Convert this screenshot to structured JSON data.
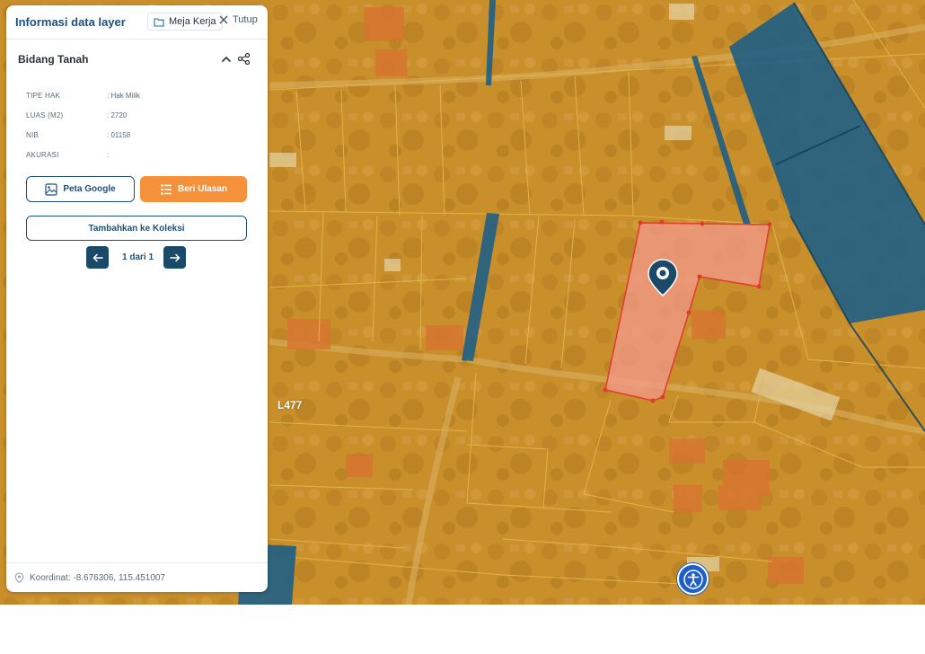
{
  "panel": {
    "title": "Informasi data layer",
    "meja_kerja_label": "Meja Kerja",
    "tutup_label": "Tutup",
    "section_title": "Bidang Tanah",
    "attributes": [
      {
        "key": "TIPE HAK",
        "value": ": Hak Milik"
      },
      {
        "key": "LUAS (M2)",
        "value": ": 2720"
      },
      {
        "key": "NIB",
        "value": ": 01158"
      },
      {
        "key": "AKURASI",
        "value": ":"
      }
    ],
    "buttons": {
      "peta_google": "Peta Google",
      "beri_ulasan": "Beri Ulasan",
      "tambahkan_koleksi": "Tambahkan ke Koleksi"
    },
    "pager": {
      "text": "1 dari 1"
    },
    "footer": {
      "coordinates": "Koordinat: -8.676306, 115.451007"
    }
  },
  "map": {
    "label": "L477",
    "colors": {
      "base": "#c98f2a",
      "parcel_line": "#e0b34a",
      "water": "#1f5f86",
      "selected_fill": "#f39a8c",
      "selected_stroke": "#e23b2e",
      "accent": "#f5913a",
      "brand": "#1f4f7a"
    }
  }
}
